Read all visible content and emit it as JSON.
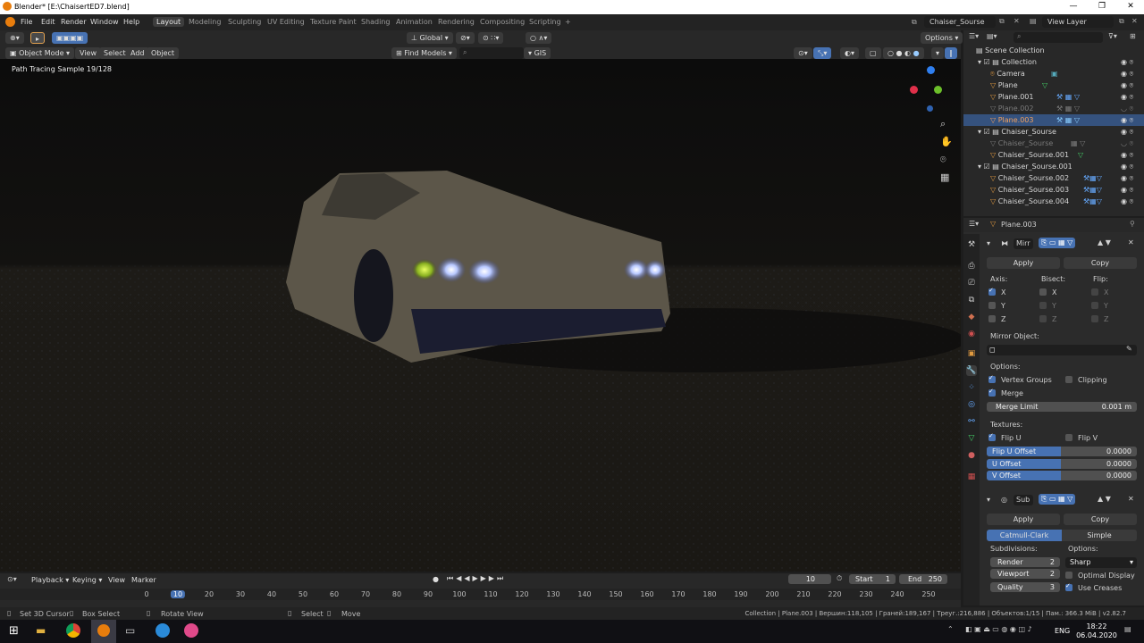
{
  "window": {
    "title": "Blender* [E:\\ChaisertED7.blend]"
  },
  "menu": [
    "File",
    "Edit",
    "Render",
    "Window",
    "Help"
  ],
  "workspaces": [
    "Layout",
    "Modeling",
    "Sculpting",
    "UV Editing",
    "Texture Paint",
    "Shading",
    "Animation",
    "Rendering",
    "Compositing",
    "Scripting",
    "+"
  ],
  "scene": {
    "name": "Chaiser_Sourse",
    "view_layer": "View Layer"
  },
  "viewport_header": {
    "mode": "Object Mode",
    "view": "View",
    "select": "Select",
    "add": "Add",
    "object": "Object",
    "transform": "Global",
    "find_models": "Find Models",
    "gis": "GIS",
    "options": "Options"
  },
  "viewport": {
    "sample_text": "Path Tracing Sample 19/128"
  },
  "outliner": {
    "root": "Scene Collection",
    "rows": [
      {
        "name": "Collection",
        "level": 0
      },
      {
        "name": "Camera",
        "level": 1
      },
      {
        "name": "Plane",
        "level": 1
      },
      {
        "name": "Plane.001",
        "level": 1
      },
      {
        "name": "Plane.002",
        "level": 1
      },
      {
        "name": "Plane.003",
        "level": 1
      },
      {
        "name": "Chaiser_Sourse",
        "level": 0
      },
      {
        "name": "Chaiser_Sourse",
        "level": 1
      },
      {
        "name": "Chaiser_Sourse.001",
        "level": 1
      },
      {
        "name": "Chaiser_Sourse.001",
        "level": 0
      },
      {
        "name": "Chaiser_Sourse.002",
        "level": 1
      },
      {
        "name": "Chaiser_Sourse.003",
        "level": 1
      },
      {
        "name": "Chaiser_Sourse.004",
        "level": 1
      }
    ]
  },
  "properties": {
    "object": "Plane.003",
    "mirror": {
      "name": "Mirr",
      "apply": "Apply",
      "copy": "Copy",
      "axis": "Axis:",
      "bisect": "Bisect:",
      "flip": "Flip:",
      "x": "X",
      "y": "Y",
      "z": "Z",
      "mirror_object": "Mirror Object:",
      "options": "Options:",
      "vertex_groups": "Vertex Groups",
      "clipping": "Clipping",
      "merge": "Merge",
      "merge_limit_label": "Merge Limit",
      "merge_limit": "0.001 m",
      "textures": "Textures:",
      "flip_u": "Flip U",
      "flip_v": "Flip V",
      "flip_u_offset": "Flip U Offset",
      "flip_u_offset_val": "0.0000",
      "u_offset": "U Offset",
      "u_offset_val": "0.0000",
      "v_offset": "V Offset",
      "v_offset_val": "0.0000"
    },
    "subsurf": {
      "name": "Sub",
      "apply": "Apply",
      "copy": "Copy",
      "catmull": "Catmull-Clark",
      "simple": "Simple",
      "subdivisions": "Subdivisions:",
      "options": "Options:",
      "render": "Render",
      "render_val": "2",
      "viewport": "Viewport",
      "viewport_val": "2",
      "quality": "Quality",
      "quality_val": "3",
      "sharp": "Sharp",
      "optimal": "Optimal Display",
      "creases": "Use Creases"
    }
  },
  "timeline": {
    "playback": "Playback",
    "keying": "Keying",
    "view": "View",
    "marker": "Marker",
    "current_frame": "10",
    "start_label": "Start",
    "start": "1",
    "end_label": "End",
    "end": "250",
    "ticks": [
      "0",
      "10",
      "20",
      "30",
      "40",
      "50",
      "60",
      "70",
      "80",
      "90",
      "100",
      "110",
      "120",
      "130",
      "140",
      "150",
      "160",
      "170",
      "180",
      "190",
      "200",
      "210",
      "220",
      "230",
      "240",
      "250"
    ]
  },
  "status": {
    "cursor": "Set 3D Cursor",
    "box": "Box Select",
    "rotate": "Rotate View",
    "select": "Select",
    "move": "Move",
    "info": "Collection | Plane.003 | Вершин:118,105 | Граней:189,167 | Треуг.:216,886 | Объектов:1/15 | Пам.: 366.3 MiB | v2.82.7"
  },
  "taskbar": {
    "lang": "ENG",
    "time": "18:22",
    "date": "06.04.2020"
  },
  "colors": {
    "accent": "#4772b3",
    "selection": "#35527e",
    "bg": "#1d1d1d"
  }
}
